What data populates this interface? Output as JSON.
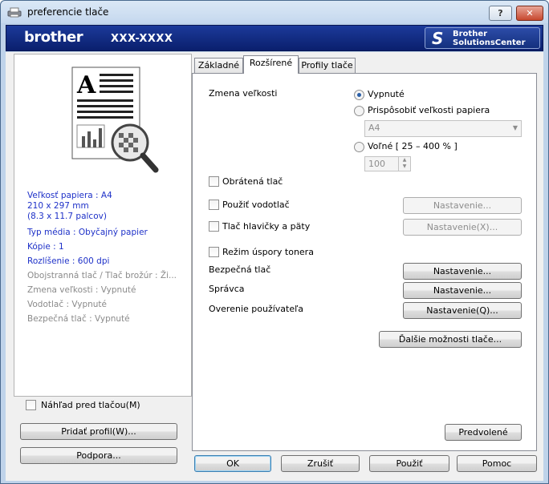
{
  "window": {
    "title": "preferencie tlače",
    "help_btn": "?",
    "close_btn": "✕"
  },
  "banner": {
    "logo": "brother",
    "model": "XXX-XXXX",
    "solutions_line1": "Brother",
    "solutions_line2": "SolutionsCenter"
  },
  "summary": {
    "paper_size": "Veľkosť papiera : A4",
    "dims_mm": "210 x 297 mm",
    "dims_in": "(8.3 x 11.7 palcov)",
    "media": "Typ média : Obyčajný papier",
    "copies": "Kópie : 1",
    "resolution": "Rozlíšenie : 600 dpi",
    "duplex": "Obojstranná tlač / Tlač brožúr : Ži...",
    "scaling": "Zmena veľkosti : Vypnuté",
    "watermark": "Vodotlač : Vypnuté",
    "secure": "Bezpečná tlač : Vypnuté"
  },
  "left": {
    "preview_label": "Náhľad pred tlačou(M)",
    "add_profile": "Pridať profil(W)...",
    "support": "Podpora..."
  },
  "tabs": [
    {
      "label": "Základné"
    },
    {
      "label": "Rozšírené"
    },
    {
      "label": "Profily tlače"
    }
  ],
  "advanced": {
    "scaling_label": "Zmena veľkosti",
    "opt_off": "Vypnuté",
    "opt_fit": "Prispôsobiť veľkosti papiera",
    "paper_select": "A4",
    "opt_free": "Voľné [ 25 – 400 % ]",
    "free_value": "100",
    "reverse": "Obrátená tlač",
    "watermark": "Použiť vodotlač",
    "watermark_btn": "Nastavenie...",
    "header_footer": "Tlač hlavičky a päty",
    "header_footer_btn": "Nastavenie(X)...",
    "toner_save": "Režim úspory tonera",
    "secure": "Bezpečná tlač",
    "secure_btn": "Nastavenie...",
    "admin": "Správca",
    "admin_btn": "Nastavenie...",
    "user_auth": "Overenie používateľa",
    "user_auth_btn": "Nastavenie(Q)...",
    "more": "Ďalšie možnosti tlače...",
    "defaults": "Predvolené"
  },
  "footer": {
    "ok": "OK",
    "cancel": "Zrušiť",
    "apply": "Použiť",
    "help": "Pomoc"
  }
}
